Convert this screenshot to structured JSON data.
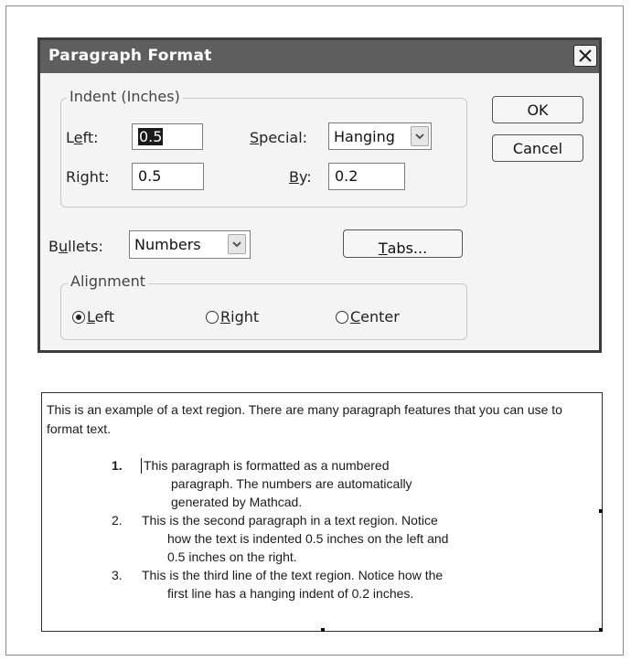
{
  "dialog": {
    "title": "Paragraph Format",
    "indent_group": {
      "legend": "Indent (Inches)",
      "left_label_pre": "L",
      "left_label_ul": "e",
      "left_label_post": "ft:",
      "left_value": "0.5",
      "right_label_pre": "Ri",
      "right_label_ul": "g",
      "right_label_post": "ht:",
      "right_value": "0.5",
      "special_label_ul": "S",
      "special_label_post": "pecial:",
      "special_value": "Hanging",
      "by_label_ul": "B",
      "by_label_post": "y:",
      "by_value": "0.2"
    },
    "bullets_label_pre": "B",
    "bullets_label_ul": "u",
    "bullets_label_post": "llets:",
    "bullets_value": "Numbers",
    "tabs_button_ul": "T",
    "tabs_button_post": "abs...",
    "ok_label": "OK",
    "cancel_label": "Cancel",
    "alignment_group": {
      "legend": "Alignment",
      "left_ul": "L",
      "left_post": "eft",
      "right_ul": "R",
      "right_post": "ight",
      "center_ul": "C",
      "center_post": "enter",
      "selected": "Left"
    }
  },
  "text_region": {
    "intro": "This is an example of a text region. There are many paragraph features that you can use to format text.",
    "items": [
      {
        "number": "1.",
        "lines": [
          "This paragraph is formatted as a numbered",
          "paragraph. The numbers are automatically",
          "generated by Mathcad."
        ]
      },
      {
        "number": "2.",
        "lines": [
          "This is the second paragraph in a text region.  Notice",
          "how the text is indented 0.5 inches on the left and",
          "0.5 inches on the right."
        ]
      },
      {
        "number": "3.",
        "lines": [
          "This is the third line of the text region. Notice how the",
          "first line has a hanging indent of 0.2 inches."
        ]
      }
    ]
  }
}
